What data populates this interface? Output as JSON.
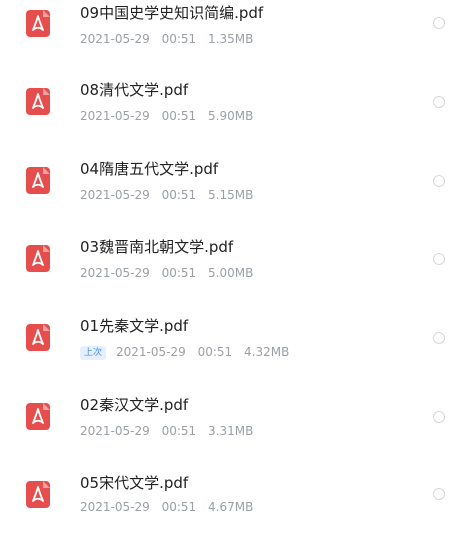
{
  "files": [
    {
      "name": "09中国史学史知识简编.pdf",
      "date": "2021-05-29",
      "time": "00:51",
      "size": "1.35MB"
    },
    {
      "name": "08清代文学.pdf",
      "date": "2021-05-29",
      "time": "00:51",
      "size": "5.90MB"
    },
    {
      "name": "04隋唐五代文学.pdf",
      "date": "2021-05-29",
      "time": "00:51",
      "size": "5.15MB"
    },
    {
      "name": "03魏晋南北朝文学.pdf",
      "date": "2021-05-29",
      "time": "00:51",
      "size": "5.00MB"
    },
    {
      "name": "01先秦文学.pdf",
      "badge": "上次",
      "date": "2021-05-29",
      "time": "00:51",
      "size": "4.32MB"
    },
    {
      "name": "02秦汉文学.pdf",
      "date": "2021-05-29",
      "time": "00:51",
      "size": "3.31MB"
    },
    {
      "name": "05宋代文学.pdf",
      "date": "2021-05-29",
      "time": "00:51",
      "size": "4.67MB"
    }
  ],
  "icon": "pdf-file-icon",
  "colors": {
    "pdf_icon": "#e64d4d",
    "recent_badge_text": "#4a8be0",
    "recent_badge_bg": "#e6f0fb",
    "meta_text": "#9aa0a6"
  }
}
